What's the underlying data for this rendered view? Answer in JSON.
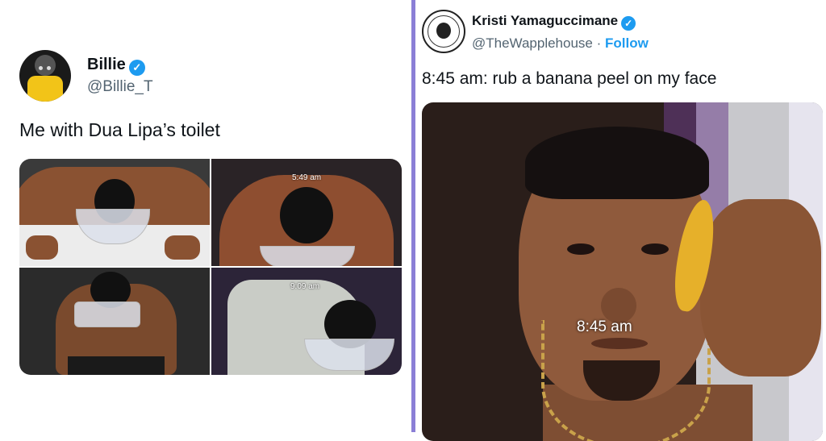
{
  "left_tweet": {
    "name": "Billie",
    "handle": "@Billie_T",
    "text": "Me with Dua Lipa’s toilet",
    "timestamps": [
      "5:49 am",
      "9:09 am"
    ]
  },
  "right_tweet": {
    "name": "Kristi Yamaguccimane",
    "handle": "@TheWapplehouse",
    "separator": "·",
    "follow_label": "Follow",
    "text": "8:45 am: rub a banana peel on my face",
    "image_caption": "8:45 am"
  },
  "colors": {
    "verified": "#1d9bf0",
    "divider": "#8b7fd6",
    "follow": "#1d9bf0"
  },
  "icons": {
    "verified": "verified-badge-icon"
  }
}
